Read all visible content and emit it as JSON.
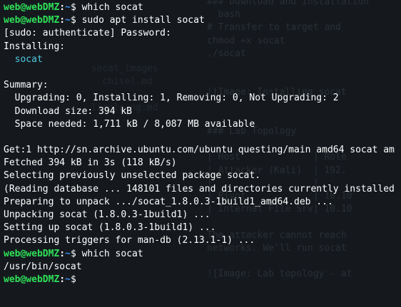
{
  "prompt": {
    "user_host": "web@webDMZ",
    "colon": ":",
    "path": "~",
    "symbol": "$"
  },
  "colors": {
    "background": "#15191e",
    "prompt_user": "#2fdf58",
    "prompt_path": "#3b8eea",
    "package_name": "#4ec9e0",
    "text": "#ffffff"
  },
  "terminal": {
    "lines": [
      {
        "kind": "prompt",
        "cmd": " which socat"
      },
      {
        "kind": "prompt",
        "cmd": " sudo apt install socat"
      },
      {
        "kind": "output",
        "text": "[sudo: authenticate] Password:"
      },
      {
        "kind": "output",
        "text": "Installing:"
      },
      {
        "kind": "package",
        "text": "  socat"
      },
      {
        "kind": "output",
        "text": ""
      },
      {
        "kind": "output",
        "text": "Summary:"
      },
      {
        "kind": "output",
        "text": "  Upgrading: 0, Installing: 1, Removing: 0, Not Upgrading: 2"
      },
      {
        "kind": "output",
        "text": "  Download size: 394 kB"
      },
      {
        "kind": "output",
        "text": "  Space needed: 1,711 kB / 8,087 MB available"
      },
      {
        "kind": "output",
        "text": ""
      },
      {
        "kind": "output",
        "text": "Get:1 http://sn.archive.ubuntu.com/ubuntu questing/main amd64 socat am"
      },
      {
        "kind": "output",
        "text": "Fetched 394 kB in 3s (118 kB/s)"
      },
      {
        "kind": "output",
        "text": "Selecting previously unselected package socat."
      },
      {
        "kind": "output",
        "text": "(Reading database ... 148101 files and directories currently installed"
      },
      {
        "kind": "output",
        "text": "Preparing to unpack .../socat_1.8.0.3-1build1_amd64.deb ..."
      },
      {
        "kind": "output",
        "text": "Unpacking socat (1.8.0.3-1build1) ..."
      },
      {
        "kind": "output",
        "text": "Setting up socat (1.8.0.3-1build1) ..."
      },
      {
        "kind": "output",
        "text": "Processing triggers for man-db (2.13.1-1) ..."
      },
      {
        "kind": "prompt",
        "cmd": " which socat"
      },
      {
        "kind": "output",
        "text": "/usr/bin/socat"
      },
      {
        "kind": "prompt",
        "cmd": ""
      }
    ]
  }
}
